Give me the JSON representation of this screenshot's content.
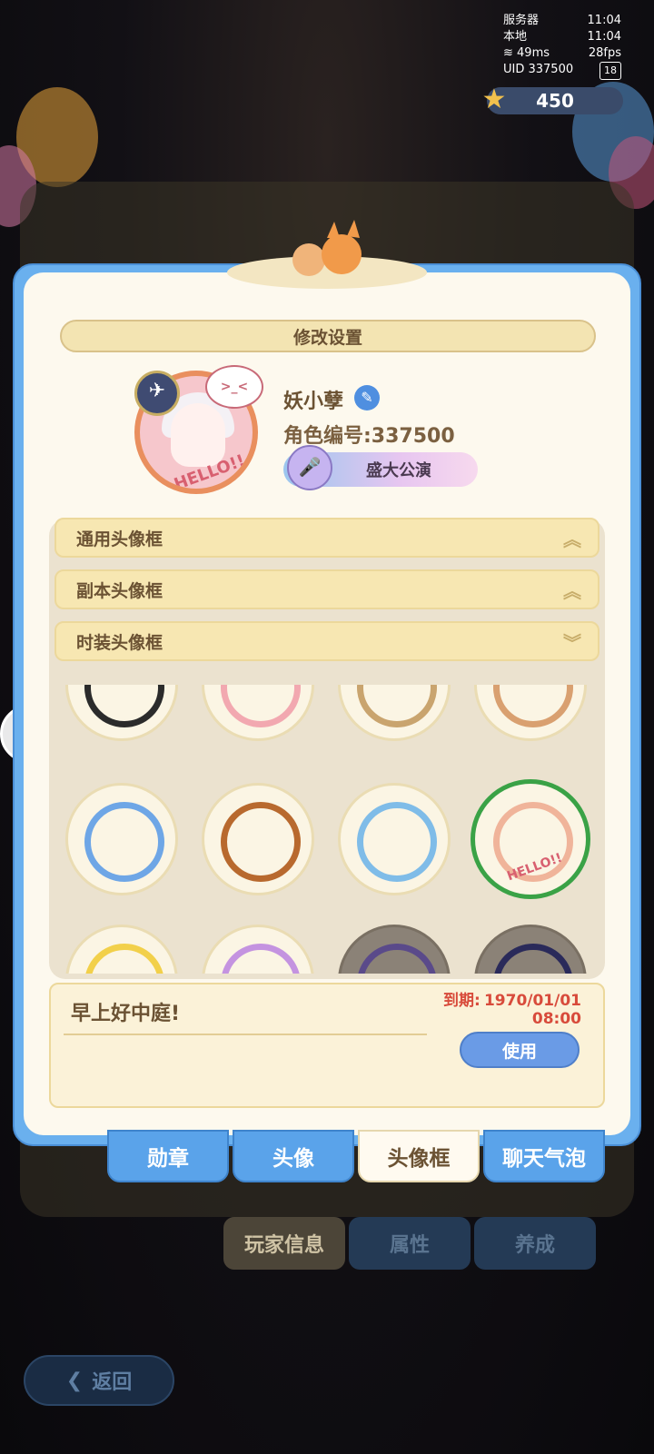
{
  "status": {
    "server_label": "服务器",
    "server_time": "11:04",
    "local_label": "本地",
    "local_time": "11:04",
    "ping": "49ms",
    "fps": "28fps",
    "uid": "UID 337500",
    "battery": "18"
  },
  "currency": {
    "amount": "450",
    "icon": "star-gem-icon"
  },
  "modal": {
    "title": "修改设置",
    "player_name": "妖小孽",
    "player_id": "角色编号:337500",
    "title_badge": "盛大公演",
    "avatar_text": "HELLO!!"
  },
  "categories": [
    {
      "label": "通用头像框",
      "state": "collapsed"
    },
    {
      "label": "副本头像框",
      "state": "collapsed"
    },
    {
      "label": "时装头像框",
      "state": "expanded"
    }
  ],
  "frames": [
    {
      "ring": "#2b2b2b"
    },
    {
      "ring": "#f2a8b0"
    },
    {
      "ring": "#c9a46e"
    },
    {
      "ring": "#d9a070"
    },
    {
      "ring": "#6ea6e6"
    },
    {
      "ring": "#b8692e"
    },
    {
      "ring": "#7fbce8"
    },
    {
      "ring": "#f0b49a",
      "selected": true,
      "label": "HELLO!!"
    },
    {
      "ring": "#f2d04a"
    },
    {
      "ring": "#c493e0"
    },
    {
      "ring": "#5a4a8a",
      "dark": true
    },
    {
      "ring": "#2a2a5a",
      "dark": true
    }
  ],
  "detail": {
    "name": "早上好中庭!",
    "expire_label": "到期:",
    "expire_date": "1970/01/01",
    "expire_time": "08:00",
    "use_label": "使用"
  },
  "tabs": [
    {
      "label": "勋章"
    },
    {
      "label": "头像"
    },
    {
      "label": "头像框",
      "active": true
    },
    {
      "label": "聊天气泡"
    }
  ],
  "bottom_tabs": [
    {
      "label": "玩家信息"
    },
    {
      "label": "属性"
    },
    {
      "label": "养成"
    }
  ],
  "back_label": "返回",
  "colors": {
    "accent_blue": "#5aa3ea",
    "selected_green": "#3aa246",
    "expire_red": "#d84b3b"
  }
}
